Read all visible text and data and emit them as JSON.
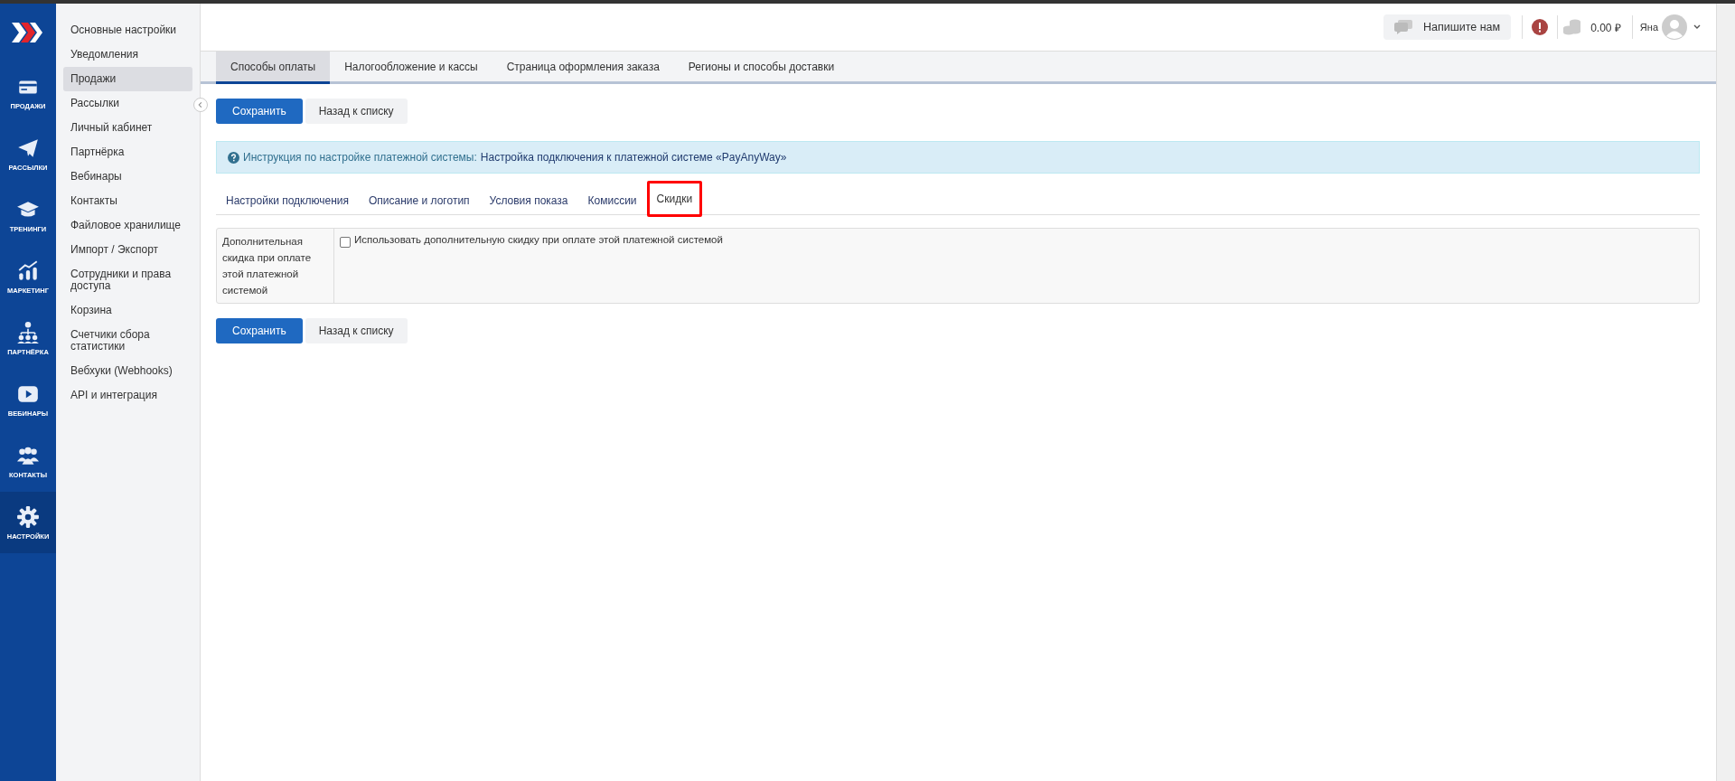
{
  "rail": [
    {
      "label": "ПРОДАЖИ",
      "kind": "card",
      "selected": false
    },
    {
      "label": "РАССЫЛКИ",
      "kind": "plane",
      "selected": false
    },
    {
      "label": "ТРЕНИНГИ",
      "kind": "cap",
      "selected": false
    },
    {
      "label": "МАРКЕТИНГ",
      "kind": "chart",
      "selected": false
    },
    {
      "label": "ПАРТНЁРКА",
      "kind": "tree",
      "selected": false
    },
    {
      "label": "ВЕБИНАРЫ",
      "kind": "play",
      "selected": false
    },
    {
      "label": "КОНТАКТЫ",
      "kind": "people",
      "selected": false
    },
    {
      "label": "НАСТРОЙКИ",
      "kind": "gear",
      "selected": true
    }
  ],
  "submenu": [
    {
      "label": "Основные настройки",
      "selected": false
    },
    {
      "label": "Уведомления",
      "selected": false
    },
    {
      "label": "Продажи",
      "selected": true
    },
    {
      "label": "Рассылки",
      "selected": false
    },
    {
      "label": "Личный кабинет",
      "selected": false
    },
    {
      "label": "Партнёрка",
      "selected": false
    },
    {
      "label": "Вебинары",
      "selected": false
    },
    {
      "label": "Контакты",
      "selected": false
    },
    {
      "label": "Файловое хранилище",
      "selected": false
    },
    {
      "label": "Импорт / Экспорт",
      "selected": false
    },
    {
      "label": "Сотрудники и права доступа",
      "selected": false
    },
    {
      "label": "Корзина",
      "selected": false
    },
    {
      "label": "Счетчики сбора статистики",
      "selected": false
    },
    {
      "label": "Вебхуки (Webhooks)",
      "selected": false
    },
    {
      "label": "API и интеграция",
      "selected": false
    }
  ],
  "header": {
    "chat_button": "Напишите нам",
    "balance": "0.00 ₽",
    "user": "Яна"
  },
  "tabs": [
    {
      "label": "Способы оплаты",
      "selected": true
    },
    {
      "label": "Налогообложение и кассы",
      "selected": false
    },
    {
      "label": "Страница оформления заказа",
      "selected": false
    },
    {
      "label": "Регионы и способы доставки",
      "selected": false
    }
  ],
  "top_buttons": {
    "save": "Сохранить",
    "back": "Назад к списку"
  },
  "info": {
    "prefix": "Инструкция по настройке платежной системы:",
    "link": "Настройка подключения к платежной системе «PayAnyWay»"
  },
  "inner_tabs": [
    {
      "label": "Настройки подключения",
      "selected": false,
      "highlighted": false
    },
    {
      "label": "Описание и логотип",
      "selected": false,
      "highlighted": false
    },
    {
      "label": "Условия показа",
      "selected": false,
      "highlighted": false
    },
    {
      "label": "Комиссии",
      "selected": false,
      "highlighted": false
    },
    {
      "label": "Скидки",
      "selected": true,
      "highlighted": true
    }
  ],
  "form": {
    "label": "Дополнительная скидка при оплате этой платежной системой",
    "checkbox": {
      "label": "Использовать дополнительную скидку при оплате этой платежной системой",
      "checked": false
    }
  },
  "bottom_buttons": {
    "save": "Сохранить",
    "back": "Назад к списку"
  }
}
